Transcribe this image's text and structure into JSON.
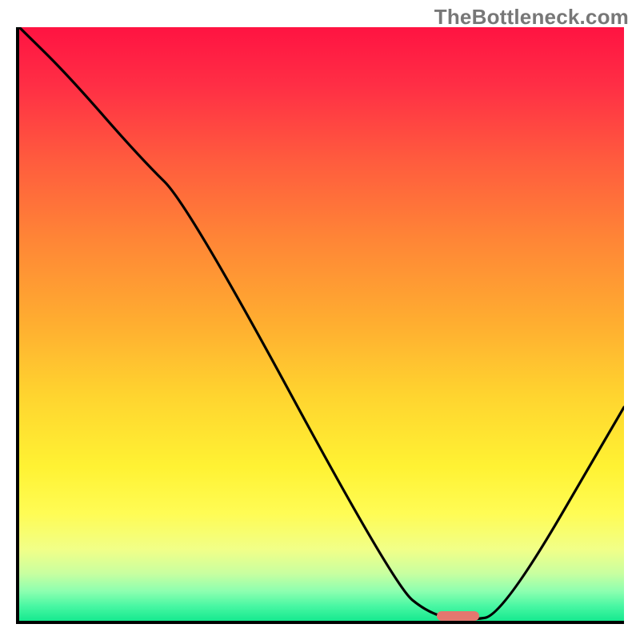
{
  "watermark": "TheBottleneck.com",
  "chart_data": {
    "type": "line",
    "title": "",
    "xlabel": "",
    "ylabel": "",
    "xlim": [
      0,
      100
    ],
    "ylim": [
      0,
      100
    ],
    "grid": false,
    "axes_visible": {
      "left": true,
      "bottom": true,
      "ticks": false
    },
    "background_gradient": {
      "direction": "vertical",
      "stops": [
        {
          "pos": 0,
          "color": "#ff1342"
        },
        {
          "pos": 0.1,
          "color": "#ff2f45"
        },
        {
          "pos": 0.22,
          "color": "#ff5a3e"
        },
        {
          "pos": 0.36,
          "color": "#ff8636"
        },
        {
          "pos": 0.5,
          "color": "#ffae30"
        },
        {
          "pos": 0.62,
          "color": "#ffd42f"
        },
        {
          "pos": 0.74,
          "color": "#fff233"
        },
        {
          "pos": 0.82,
          "color": "#fffc55"
        },
        {
          "pos": 0.88,
          "color": "#f1ff88"
        },
        {
          "pos": 0.92,
          "color": "#c9ffa0"
        },
        {
          "pos": 0.95,
          "color": "#8dffb0"
        },
        {
          "pos": 0.975,
          "color": "#49f7a3"
        },
        {
          "pos": 1.0,
          "color": "#16e98f"
        }
      ]
    },
    "series": [
      {
        "name": "bottleneck-curve",
        "color": "#000000",
        "x": [
          0,
          8,
          20,
          28,
          62,
          68,
          74,
          80,
          100
        ],
        "y": [
          100,
          92,
          78,
          70,
          6,
          1,
          0,
          1,
          36
        ]
      }
    ],
    "marker": {
      "name": "optimal-range",
      "color": "#e4776f",
      "x_start": 69,
      "x_end": 76,
      "y": 0.5
    }
  }
}
